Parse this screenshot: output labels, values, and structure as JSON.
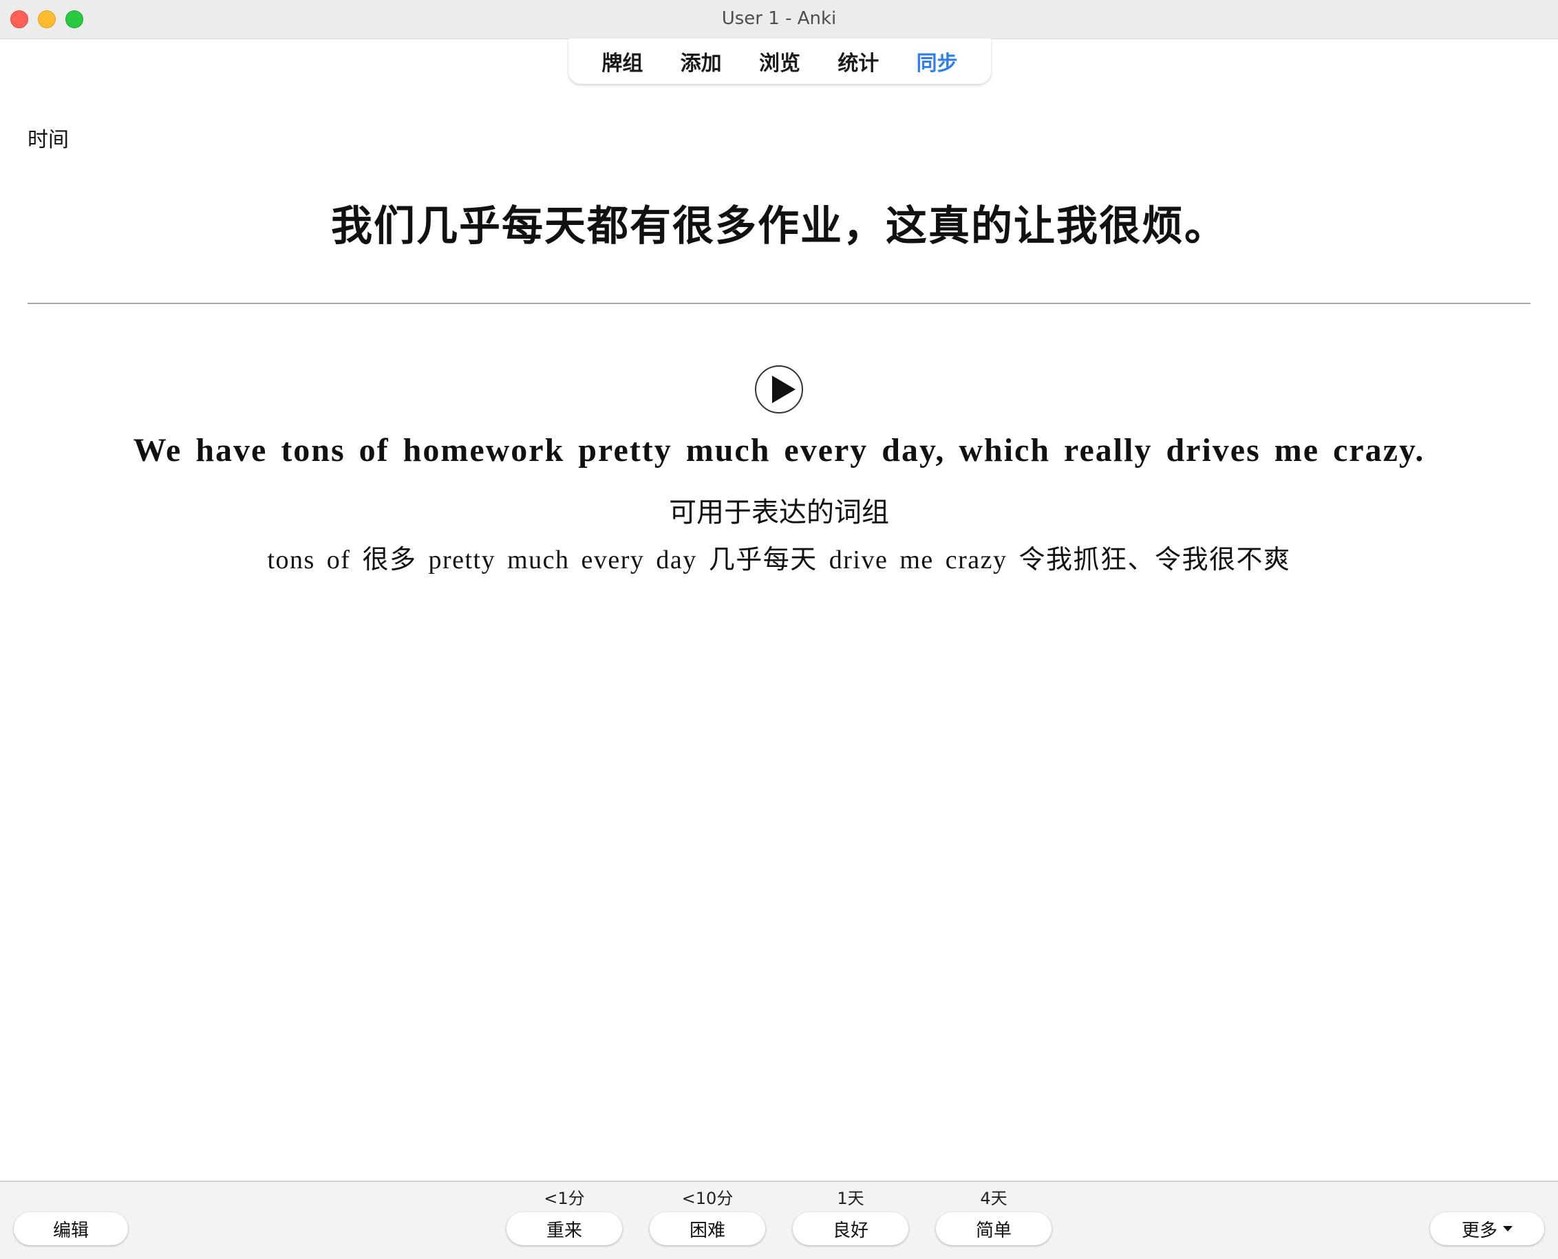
{
  "window": {
    "title": "User 1 - Anki"
  },
  "toolbar": {
    "tabs": [
      {
        "label": "牌组",
        "icon": "decks"
      },
      {
        "label": "添加",
        "icon": "add"
      },
      {
        "label": "浏览",
        "icon": "browse"
      },
      {
        "label": "统计",
        "icon": "stats"
      },
      {
        "label": "同步",
        "icon": "sync",
        "color": "#2f7ef0"
      }
    ]
  },
  "card": {
    "deck_label": "时间",
    "front_text": "我们几乎每天都有很多作业，这真的让我很烦。",
    "audio_icon": "play-icon",
    "back_english": "We have tons of homework pretty much every day, which really drives me crazy.",
    "phrase_heading": "可用于表达的词组",
    "phrases": "tons of 很多 pretty much every day 几乎每天 drive me crazy 令我抓狂、令我很不爽"
  },
  "bottom_bar": {
    "edit_label": "编辑",
    "more_label": "更多",
    "answers": [
      {
        "interval": "<1分",
        "label": "重来"
      },
      {
        "interval": "<10分",
        "label": "困难"
      },
      {
        "interval": "1天",
        "label": "良好"
      },
      {
        "interval": "4天",
        "label": "简单"
      }
    ]
  }
}
